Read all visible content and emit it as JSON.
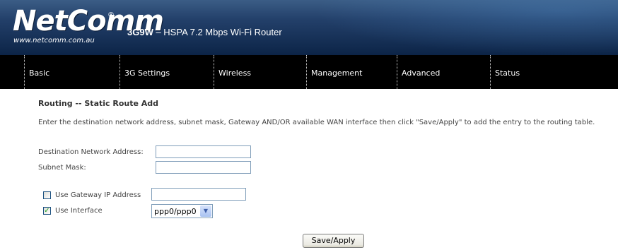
{
  "header": {
    "logo": "NetComm",
    "logo_mark": "®",
    "website": "www.netcomm.com.au",
    "model": "3G9W",
    "product_rest": " – HSPA 7.2 Mbps Wi-Fi Router"
  },
  "nav": {
    "items": [
      {
        "label": "Basic"
      },
      {
        "label": "3G Settings"
      },
      {
        "label": "Wireless"
      },
      {
        "label": "Management"
      },
      {
        "label": "Advanced"
      },
      {
        "label": "Status"
      }
    ]
  },
  "page": {
    "title": "Routing -- Static Route Add",
    "description": "Enter the destination network address, subnet mask, Gateway AND/OR available WAN interface then click \"Save/Apply\" to add the entry to the routing table."
  },
  "form": {
    "destination_label": "Destination Network Address:",
    "destination_value": "",
    "subnet_label": "Subnet Mask:",
    "subnet_value": "",
    "gateway_checkbox_label": "Use Gateway IP Address",
    "gateway_checked": false,
    "gateway_value": "",
    "interface_checkbox_label": "Use Interface",
    "interface_checked": true,
    "interface_selected": "ppp0/ppp0",
    "submit_label": "Save/Apply"
  },
  "icons": {
    "select_arrow": "chevron-down-icon",
    "checkmark": "checkmark-icon"
  }
}
